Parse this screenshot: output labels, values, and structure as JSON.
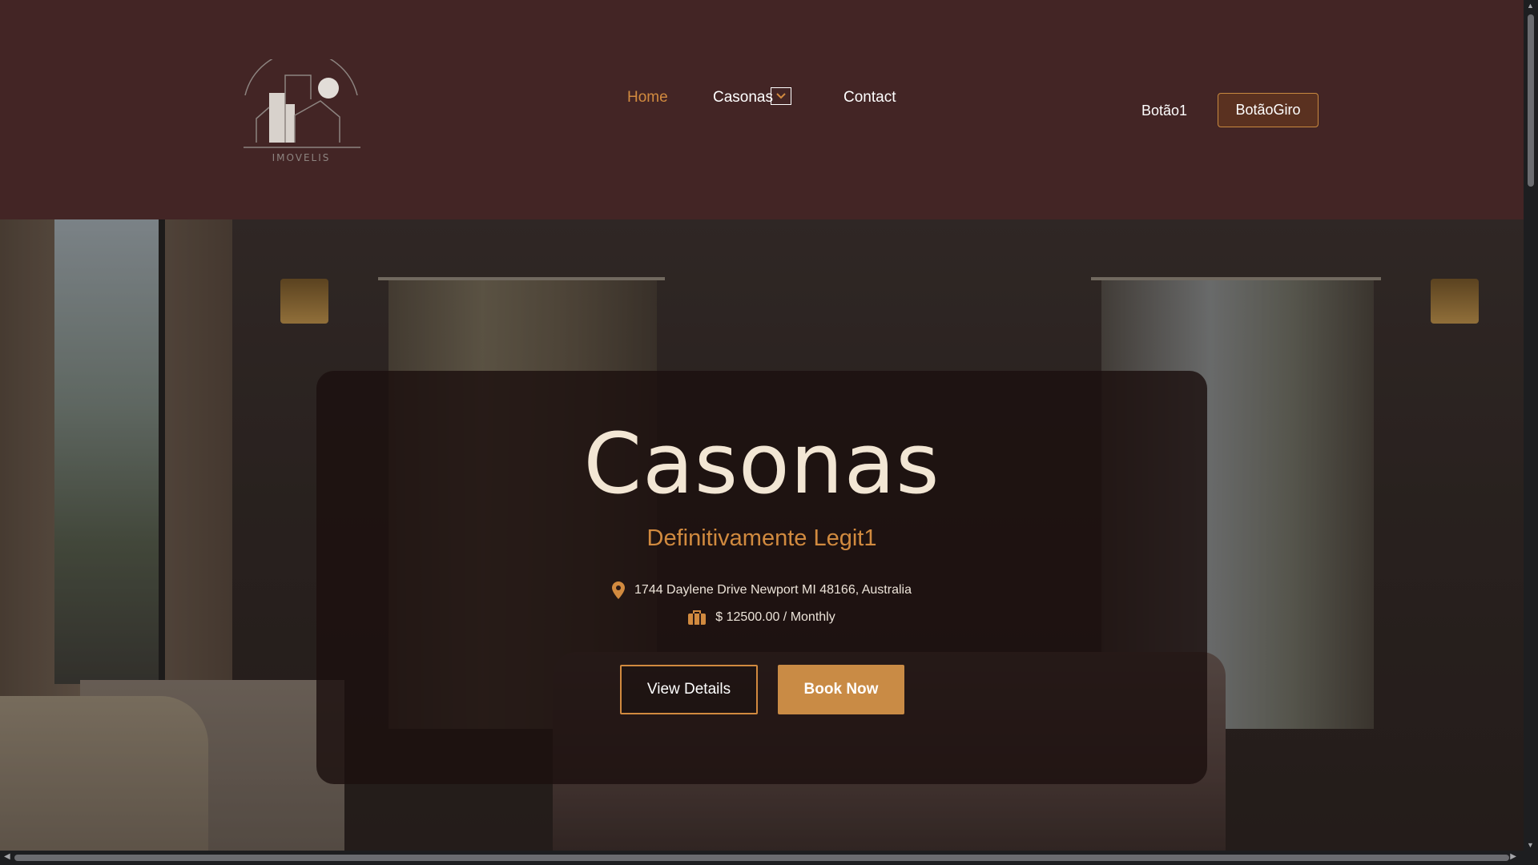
{
  "brand": {
    "logo_text": "IMOVELIS"
  },
  "nav": {
    "items": [
      {
        "label": "Home",
        "active": true
      },
      {
        "label": "Casonas",
        "active": false
      },
      {
        "label": "Contact",
        "active": false
      }
    ],
    "dropdown_icon": "chevron-down-icon"
  },
  "header_buttons": {
    "plain_label": "Botão1",
    "outline_label": "BotãoGiro"
  },
  "hero": {
    "title": "Casonas",
    "subtitle": "Definitivamente Legit1",
    "address": "1744 Daylene Drive Newport MI 48166, Australia",
    "address_icon": "map-pin-icon",
    "price": "$ 12500.00 / Monthly",
    "price_icon": "briefcase-icon",
    "view_details_label": "View Details",
    "book_now_label": "Book Now"
  },
  "colors": {
    "header_bg": "#432525",
    "accent": "#d18a3f",
    "button_fill": "#c98b45",
    "title_text": "#f2e6d4"
  }
}
